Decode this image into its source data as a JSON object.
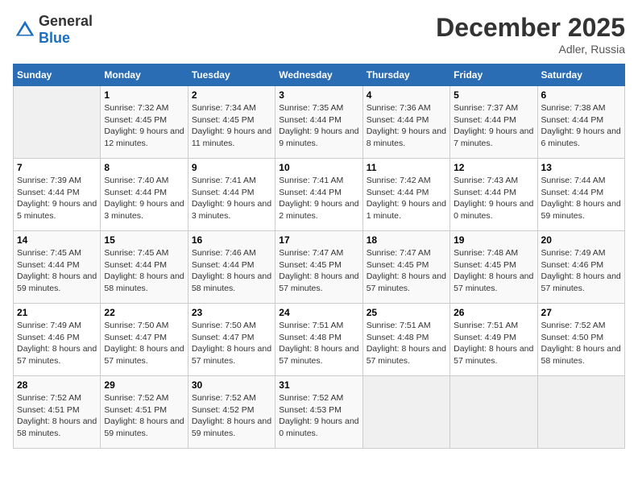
{
  "header": {
    "logo_general": "General",
    "logo_blue": "Blue",
    "month": "December 2025",
    "location": "Adler, Russia"
  },
  "days_of_week": [
    "Sunday",
    "Monday",
    "Tuesday",
    "Wednesday",
    "Thursday",
    "Friday",
    "Saturday"
  ],
  "weeks": [
    [
      {
        "day": "",
        "info": ""
      },
      {
        "day": "1",
        "info": "Sunrise: 7:32 AM\nSunset: 4:45 PM\nDaylight: 9 hours and 12 minutes."
      },
      {
        "day": "2",
        "info": "Sunrise: 7:34 AM\nSunset: 4:45 PM\nDaylight: 9 hours and 11 minutes."
      },
      {
        "day": "3",
        "info": "Sunrise: 7:35 AM\nSunset: 4:44 PM\nDaylight: 9 hours and 9 minutes."
      },
      {
        "day": "4",
        "info": "Sunrise: 7:36 AM\nSunset: 4:44 PM\nDaylight: 9 hours and 8 minutes."
      },
      {
        "day": "5",
        "info": "Sunrise: 7:37 AM\nSunset: 4:44 PM\nDaylight: 9 hours and 7 minutes."
      },
      {
        "day": "6",
        "info": "Sunrise: 7:38 AM\nSunset: 4:44 PM\nDaylight: 9 hours and 6 minutes."
      }
    ],
    [
      {
        "day": "7",
        "info": "Sunrise: 7:39 AM\nSunset: 4:44 PM\nDaylight: 9 hours and 5 minutes."
      },
      {
        "day": "8",
        "info": "Sunrise: 7:40 AM\nSunset: 4:44 PM\nDaylight: 9 hours and 3 minutes."
      },
      {
        "day": "9",
        "info": "Sunrise: 7:41 AM\nSunset: 4:44 PM\nDaylight: 9 hours and 3 minutes."
      },
      {
        "day": "10",
        "info": "Sunrise: 7:41 AM\nSunset: 4:44 PM\nDaylight: 9 hours and 2 minutes."
      },
      {
        "day": "11",
        "info": "Sunrise: 7:42 AM\nSunset: 4:44 PM\nDaylight: 9 hours and 1 minute."
      },
      {
        "day": "12",
        "info": "Sunrise: 7:43 AM\nSunset: 4:44 PM\nDaylight: 9 hours and 0 minutes."
      },
      {
        "day": "13",
        "info": "Sunrise: 7:44 AM\nSunset: 4:44 PM\nDaylight: 8 hours and 59 minutes."
      }
    ],
    [
      {
        "day": "14",
        "info": "Sunrise: 7:45 AM\nSunset: 4:44 PM\nDaylight: 8 hours and 59 minutes."
      },
      {
        "day": "15",
        "info": "Sunrise: 7:45 AM\nSunset: 4:44 PM\nDaylight: 8 hours and 58 minutes."
      },
      {
        "day": "16",
        "info": "Sunrise: 7:46 AM\nSunset: 4:44 PM\nDaylight: 8 hours and 58 minutes."
      },
      {
        "day": "17",
        "info": "Sunrise: 7:47 AM\nSunset: 4:45 PM\nDaylight: 8 hours and 57 minutes."
      },
      {
        "day": "18",
        "info": "Sunrise: 7:47 AM\nSunset: 4:45 PM\nDaylight: 8 hours and 57 minutes."
      },
      {
        "day": "19",
        "info": "Sunrise: 7:48 AM\nSunset: 4:45 PM\nDaylight: 8 hours and 57 minutes."
      },
      {
        "day": "20",
        "info": "Sunrise: 7:49 AM\nSunset: 4:46 PM\nDaylight: 8 hours and 57 minutes."
      }
    ],
    [
      {
        "day": "21",
        "info": "Sunrise: 7:49 AM\nSunset: 4:46 PM\nDaylight: 8 hours and 57 minutes."
      },
      {
        "day": "22",
        "info": "Sunrise: 7:50 AM\nSunset: 4:47 PM\nDaylight: 8 hours and 57 minutes."
      },
      {
        "day": "23",
        "info": "Sunrise: 7:50 AM\nSunset: 4:47 PM\nDaylight: 8 hours and 57 minutes."
      },
      {
        "day": "24",
        "info": "Sunrise: 7:51 AM\nSunset: 4:48 PM\nDaylight: 8 hours and 57 minutes."
      },
      {
        "day": "25",
        "info": "Sunrise: 7:51 AM\nSunset: 4:48 PM\nDaylight: 8 hours and 57 minutes."
      },
      {
        "day": "26",
        "info": "Sunrise: 7:51 AM\nSunset: 4:49 PM\nDaylight: 8 hours and 57 minutes."
      },
      {
        "day": "27",
        "info": "Sunrise: 7:52 AM\nSunset: 4:50 PM\nDaylight: 8 hours and 58 minutes."
      }
    ],
    [
      {
        "day": "28",
        "info": "Sunrise: 7:52 AM\nSunset: 4:51 PM\nDaylight: 8 hours and 58 minutes."
      },
      {
        "day": "29",
        "info": "Sunrise: 7:52 AM\nSunset: 4:51 PM\nDaylight: 8 hours and 59 minutes."
      },
      {
        "day": "30",
        "info": "Sunrise: 7:52 AM\nSunset: 4:52 PM\nDaylight: 8 hours and 59 minutes."
      },
      {
        "day": "31",
        "info": "Sunrise: 7:52 AM\nSunset: 4:53 PM\nDaylight: 9 hours and 0 minutes."
      },
      {
        "day": "",
        "info": ""
      },
      {
        "day": "",
        "info": ""
      },
      {
        "day": "",
        "info": ""
      }
    ]
  ]
}
